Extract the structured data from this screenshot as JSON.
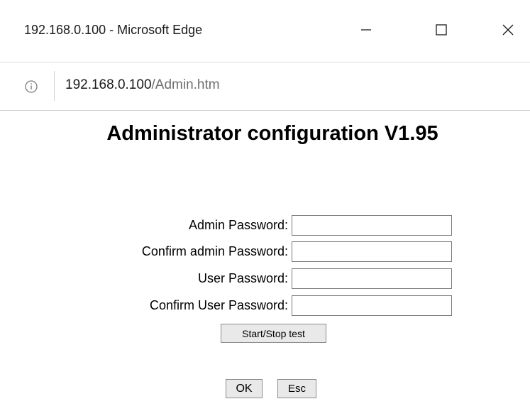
{
  "window": {
    "title": "192.168.0.100 - Microsoft Edge",
    "controls": {
      "minimize_icon": "minimize-icon",
      "maximize_icon": "maximize-icon",
      "close_icon": "close-icon"
    }
  },
  "address_bar": {
    "info_icon": "info-icon",
    "url_host": "192.168.0.100",
    "url_path": "/Admin.htm"
  },
  "page": {
    "title": "Administrator configuration V1.95"
  },
  "form": {
    "fields": [
      {
        "label": "Admin Password:",
        "value": ""
      },
      {
        "label": "Confirm admin Password:",
        "value": ""
      },
      {
        "label": "User Password:",
        "value": ""
      },
      {
        "label": "Confirm User Password:",
        "value": ""
      }
    ],
    "test_button": "Start/Stop test",
    "ok_button": "OK",
    "esc_button": "Esc"
  }
}
